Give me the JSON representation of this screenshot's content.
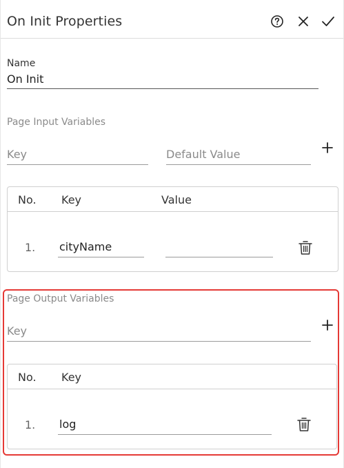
{
  "header": {
    "title": "On Init Properties",
    "icons": [
      "help-circle-icon",
      "close-icon",
      "check-icon"
    ]
  },
  "name_section": {
    "label": "Name",
    "value": "On Init"
  },
  "page_input": {
    "section_label": "Page Input Variables",
    "key_placeholder": "Key",
    "default_value_placeholder": "Default Value",
    "add_icon": "plus-icon",
    "table": {
      "columns": [
        "No.",
        "Key",
        "Value"
      ],
      "rows": [
        {
          "no": "1.",
          "key": "cityName",
          "value": ""
        }
      ]
    }
  },
  "page_output": {
    "section_label": "Page Output Variables",
    "key_placeholder": "Key",
    "add_icon": "plus-icon",
    "table": {
      "columns": [
        "No.",
        "Key"
      ],
      "rows": [
        {
          "no": "1.",
          "key": "log"
        }
      ]
    }
  },
  "colors": {
    "highlight": "#e53935",
    "border": "#cfcfcf",
    "muted_text": "#8a8a8a"
  }
}
